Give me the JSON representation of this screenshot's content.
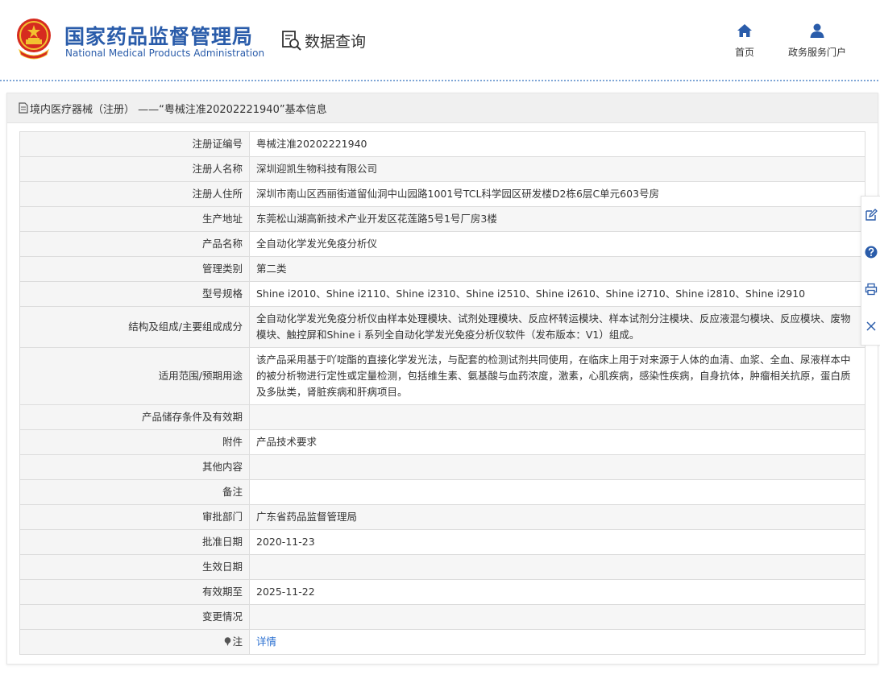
{
  "header": {
    "brand_cn": "国家药品监督管理局",
    "brand_en": "National Medical Products Administration",
    "query_label": "数据查询",
    "nav": [
      {
        "label": "首页",
        "icon": "home-icon"
      },
      {
        "label": "政务服务门户",
        "icon": "user-icon"
      }
    ]
  },
  "panel": {
    "title": "境内医疗器械（注册） ——“粤械注准20202221940”基本信息"
  },
  "rows": [
    {
      "label": "注册证编号",
      "value": "粤械注准20202221940"
    },
    {
      "label": "注册人名称",
      "value": "深圳迎凯生物科技有限公司"
    },
    {
      "label": "注册人住所",
      "value": "深圳市南山区西丽街道留仙洞中山园路1001号TCL科学园区研发楼D2栋6层C单元603号房"
    },
    {
      "label": "生产地址",
      "value": "东莞松山湖高新技术产业开发区花莲路5号1号厂房3楼"
    },
    {
      "label": "产品名称",
      "value": "全自动化学发光免疫分析仪"
    },
    {
      "label": "管理类别",
      "value": "第二类"
    },
    {
      "label": "型号规格",
      "value": "Shine i2010、Shine i2110、Shine i2310、Shine i2510、Shine i2610、Shine i2710、Shine i2810、Shine i2910"
    },
    {
      "label": "结构及组成/主要组成成分",
      "value": "全自动化学发光免疫分析仪由样本处理模块、试剂处理模块、反应杯转运模块、样本试剂分注模块、反应液混匀模块、反应模块、废物模块、触控屏和Shine i 系列全自动化学发光免疫分析仪软件（发布版本：V1）组成。"
    },
    {
      "label": "适用范围/预期用途",
      "value": "该产品采用基于吖啶酯的直接化学发光法，与配套的检测试剂共同使用，在临床上用于对来源于人体的血清、血浆、全血、尿液样本中的被分析物进行定性或定量检测，包括维生素、氨基酸与血药浓度，激素，心肌疾病，感染性疾病，自身抗体，肿瘤相关抗原，蛋白质及多肽类，肾脏疾病和肝病项目。"
    },
    {
      "label": "产品储存条件及有效期",
      "value": ""
    },
    {
      "label": "附件",
      "value": "产品技术要求"
    },
    {
      "label": "其他内容",
      "value": ""
    },
    {
      "label": "备注",
      "value": ""
    },
    {
      "label": "审批部门",
      "value": "广东省药品监督管理局"
    },
    {
      "label": "批准日期",
      "value": "2020-11-23"
    },
    {
      "label": "生效日期",
      "value": ""
    },
    {
      "label": "有效期至",
      "value": "2025-11-22"
    },
    {
      "label": "变更情况",
      "value": ""
    },
    {
      "label": "注",
      "value": "详情"
    }
  ],
  "side_tools": [
    "edit-icon",
    "help-icon",
    "print-icon",
    "close-icon"
  ]
}
